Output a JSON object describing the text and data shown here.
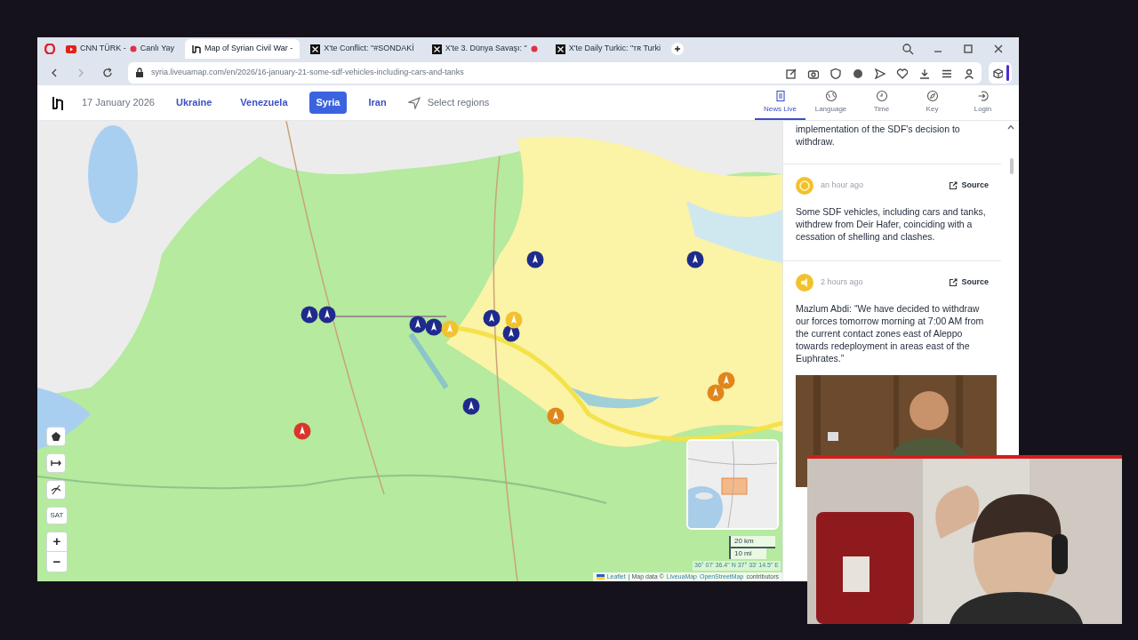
{
  "browser": {
    "tabs": [
      {
        "title": "CNN TÜRK -",
        "live_dot": true,
        "title_rest": "Canlı Yay",
        "selected": false
      },
      {
        "title": "Map of Syrian Civil War -",
        "live_dot": false,
        "selected": true
      },
      {
        "title": "X'te Conflict: \"#SONDAKİ",
        "live_dot": false,
        "selected": false
      },
      {
        "title": "X'te 3. Dünya Savaşı: \"",
        "live_dot": true,
        "selected": false
      },
      {
        "title": "X'te Daily Turkic: \"ᴛʀ Turki",
        "live_dot": false,
        "selected": false
      }
    ],
    "url_host": "syria.liveuamap.com",
    "url_path": "/en/2026/16-january-21-some-sdf-vehicles-including-cars-and-tanks"
  },
  "site": {
    "date": "17 January 2026",
    "regions": [
      {
        "label": "Ukraine",
        "selected": false
      },
      {
        "label": "Venezuela",
        "selected": false
      },
      {
        "label": "Syria",
        "selected": true
      },
      {
        "label": "Iran",
        "selected": false
      }
    ],
    "select_regions": "Select regions",
    "menu": [
      {
        "label": "News Live",
        "selected": true
      },
      {
        "label": "Language",
        "selected": false
      },
      {
        "label": "Time",
        "selected": false
      },
      {
        "label": "Key",
        "selected": false
      },
      {
        "label": "Login",
        "selected": false
      }
    ]
  },
  "map": {
    "markers": [
      {
        "color": "#1f2b8c"
      },
      {
        "color": "#1f2b8c"
      },
      {
        "color": "#1f2b8c"
      },
      {
        "color": "#1f2b8c"
      },
      {
        "color": "#1f2b8c"
      },
      {
        "color": "#1f2b8c"
      },
      {
        "color": "#1f2b8c"
      },
      {
        "color": "#1f2b8c"
      },
      {
        "color": "#1f2b8c"
      },
      {
        "color": "#f2c12e"
      },
      {
        "color": "#f2c12e"
      },
      {
        "color": "#e0861a"
      },
      {
        "color": "#e0861a"
      },
      {
        "color": "#e0861a"
      },
      {
        "color": "#d9362b"
      }
    ],
    "sat_button": "SAT",
    "zoom_in": "+",
    "zoom_out": "−",
    "scale": [
      "20 km",
      "10 mi"
    ],
    "coordinates": "36° 07' 36.4\" N 37° 33' 14.5\" E",
    "attribution": {
      "leaflet": "Leaflet",
      "text": "| Map data ©",
      "links": [
        "LiveuaMap",
        "OpenStreetMap"
      ],
      "suffix": "contributors"
    }
  },
  "news": [
    {
      "text": "implementation of the SDF's decision to withdraw."
    },
    {
      "time": "an hour ago",
      "source": "Source",
      "text": "Some SDF vehicles, including cars and tanks, withdrew from Deir Hafer, coinciding with a cessation of shelling and clashes."
    },
    {
      "time": "2 hours ago",
      "source": "Source",
      "text": "Mazlum Abdi: “We have decided to withdraw our forces tomorrow morning at 7:00 AM from the current contact zones east of Aleppo towards redeployment in areas east of the Euphrates.”"
    }
  ]
}
